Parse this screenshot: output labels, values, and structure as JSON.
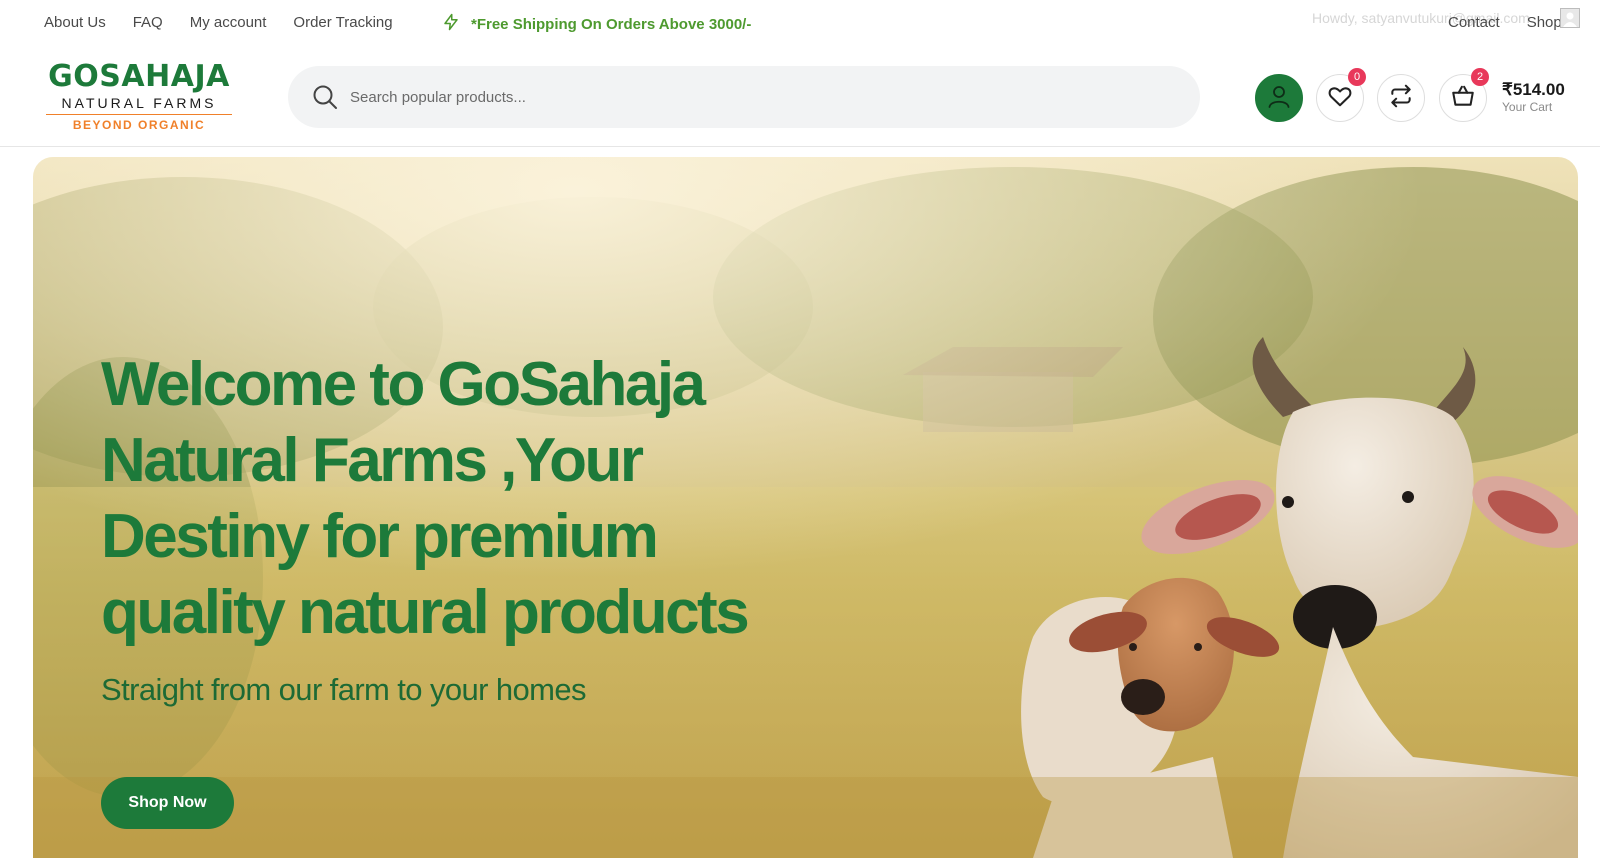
{
  "topbar": {
    "links": [
      "About Us",
      "FAQ",
      "My account",
      "Order Tracking"
    ],
    "promo": "*Free Shipping On Orders Above 3000/-",
    "howdy": "Howdy, satyanvutukuri@gmail.com",
    "right_links": [
      "Contact",
      "Shop"
    ]
  },
  "logo": {
    "main": "GOSAHAJA",
    "sub": "NATURAL FARMS",
    "tagline": "BEYOND ORGANIC"
  },
  "search": {
    "placeholder": "Search popular products..."
  },
  "header_actions": {
    "wishlist_count": "0",
    "cart_count": "2",
    "cart_total": "₹514.00",
    "cart_label": "Your Cart"
  },
  "hero": {
    "title": "Welcome to GoSahaja Natural Farms ,Your Destiny for premium quality natural products",
    "subtitle": "Straight from our farm to your homes",
    "cta": "Shop Now"
  },
  "colors": {
    "brand_green": "#1d7a3a",
    "promo_green": "#4e9a2f",
    "accent_orange": "#f0802a",
    "badge_red": "#e8385a"
  }
}
